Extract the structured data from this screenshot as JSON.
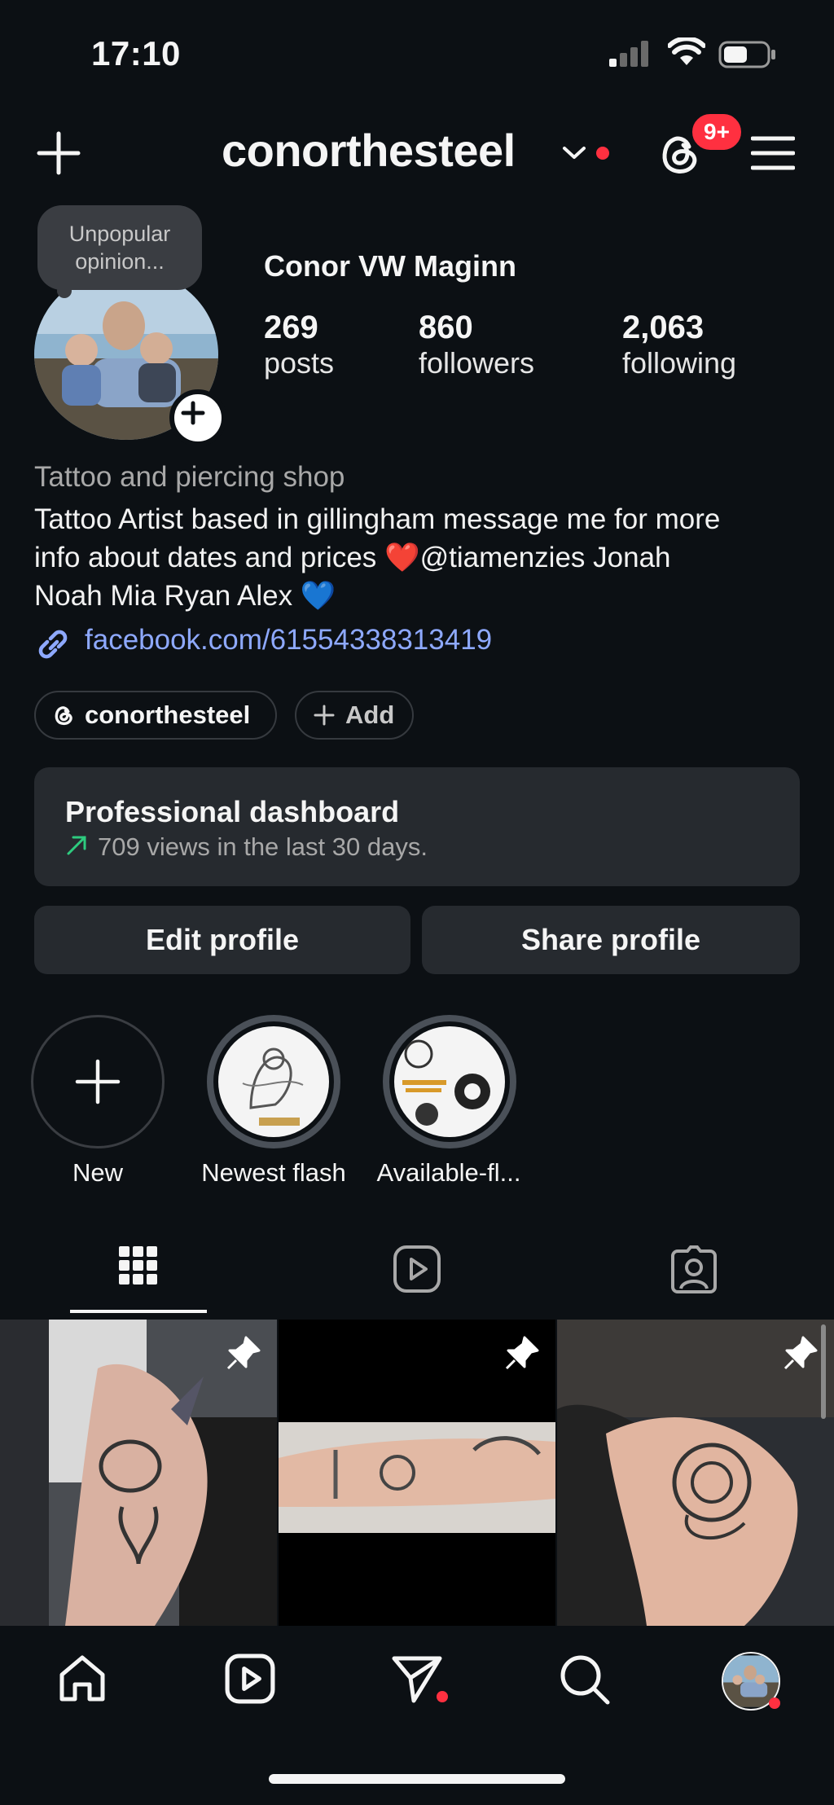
{
  "status_bar": {
    "time": "17:10"
  },
  "header": {
    "username": "conorthesteel",
    "notification_badge": "9+",
    "icons": [
      "plus-icon",
      "chevron-down-icon",
      "threads-icon",
      "menu-icon"
    ]
  },
  "profile": {
    "note": "Unpopular opinion...",
    "full_name": "Conor VW Maginn",
    "stats": [
      {
        "value": "269",
        "label": "posts"
      },
      {
        "value": "860",
        "label": "followers"
      },
      {
        "value": "2,063",
        "label": "following"
      }
    ],
    "category": "Tattoo and piercing shop",
    "bio": {
      "line1": "Tattoo Artist based in gillingham message me for more",
      "line2": "info about dates and prices ❤️@tiamenzies Jonah",
      "line3": "Noah Mia Ryan Alex 💙"
    },
    "link": "facebook.com/61554338313419",
    "threads_pill": "conorthesteel",
    "add_pill": "Add"
  },
  "dashboard": {
    "title": "Professional dashboard",
    "subtitle": "709 views in the last 30 days."
  },
  "actions": {
    "edit": "Edit profile",
    "share": "Share profile"
  },
  "highlights": [
    {
      "label": "New"
    },
    {
      "label": "Newest flash"
    },
    {
      "label": "Available-fl..."
    }
  ],
  "tabs": [
    "grid-icon",
    "reels-icon",
    "tagged-icon"
  ],
  "nav": [
    "home-icon",
    "reels-icon",
    "messages-icon",
    "search-icon",
    "profile-avatar"
  ],
  "colors": {
    "accent_red": "#ff3040",
    "link_blue": "#8ea9ff",
    "background": "#0c1014",
    "card": "#262a2f"
  }
}
